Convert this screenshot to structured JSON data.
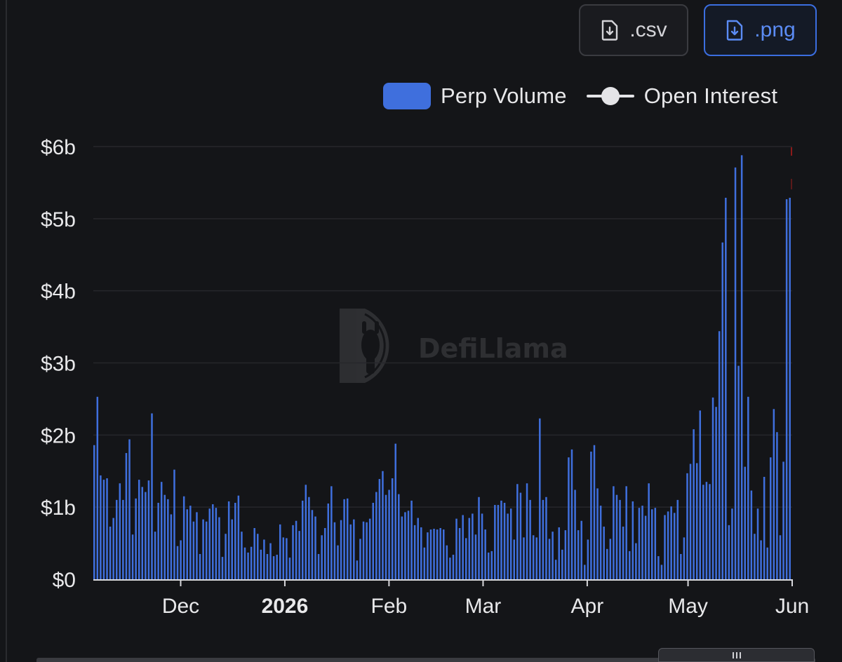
{
  "toolbar": {
    "csv_label": ".csv",
    "png_label": ".png",
    "icon": "file-download-icon"
  },
  "legend": {
    "items": [
      {
        "label": "Perp Volume",
        "color": "#3f6fdd",
        "icon": "bar-swatch"
      },
      {
        "label": "Open Interest",
        "color": "#e4e4e7",
        "icon": "line-dot-swatch"
      }
    ]
  },
  "watermark": "DefiLlama",
  "chart_data": {
    "type": "bar",
    "title": "",
    "xlabel": "",
    "ylabel": "",
    "ylim": [
      0,
      6000000000
    ],
    "y_ticks": [
      {
        "value": 0,
        "label": "$0"
      },
      {
        "value": 1000000000,
        "label": "$1b"
      },
      {
        "value": 2000000000,
        "label": "$2b"
      },
      {
        "value": 3000000000,
        "label": "$3b"
      },
      {
        "value": 4000000000,
        "label": "$4b"
      },
      {
        "value": 5000000000,
        "label": "$5b"
      },
      {
        "value": 6000000000,
        "label": "$6b"
      }
    ],
    "x_range": [
      "2025-11-05",
      "2026-06-01"
    ],
    "x_ticks": [
      {
        "date": "2025-12-01",
        "label": "Dec",
        "bold": false
      },
      {
        "date": "2026-01-01",
        "label": "2026",
        "bold": true
      },
      {
        "date": "2026-02-01",
        "label": "Feb",
        "bold": false
      },
      {
        "date": "2026-03-01",
        "label": "Mar",
        "bold": false
      },
      {
        "date": "2026-04-01",
        "label": "Apr",
        "bold": false
      },
      {
        "date": "2026-05-01",
        "label": "May",
        "bold": false
      },
      {
        "date": "2026-06-01",
        "label": "Jun",
        "bold": false
      }
    ],
    "grid": true,
    "legend_position": "top-right",
    "series": [
      {
        "name": "Perp Volume",
        "color": "#3f6fdd",
        "values_billions": [
          1.86,
          2.53,
          1.44,
          1.38,
          1.4,
          0.73,
          0.85,
          1.1,
          1.33,
          1.1,
          1.75,
          1.94,
          0.62,
          1.12,
          1.38,
          1.28,
          1.21,
          1.37,
          2.3,
          0.66,
          1.06,
          1.35,
          1.17,
          1.11,
          0.9,
          1.52,
          0.46,
          0.54,
          1.15,
          0.97,
          1.02,
          0.8,
          0.93,
          0.35,
          0.83,
          0.8,
          0.98,
          1.04,
          0.99,
          0.86,
          0.31,
          0.63,
          1.08,
          0.83,
          1.06,
          1.16,
          0.66,
          0.44,
          0.37,
          0.45,
          0.71,
          0.63,
          0.41,
          0.55,
          0.35,
          0.5,
          0.32,
          0.34,
          0.76,
          0.58,
          0.57,
          0.3,
          0.75,
          0.81,
          0.67,
          1.09,
          1.31,
          1.14,
          0.96,
          0.87,
          0.35,
          0.61,
          0.71,
          1.05,
          1.29,
          0.79,
          0.47,
          0.82,
          1.11,
          1.12,
          0.76,
          0.83,
          0.26,
          0.56,
          0.8,
          0.79,
          0.84,
          1.06,
          1.21,
          1.39,
          1.5,
          1.17,
          1.24,
          1.4,
          1.88,
          1.18,
          0.87,
          0.93,
          0.95,
          1.09,
          0.75,
          0.85,
          0.72,
          0.44,
          0.65,
          0.69,
          0.7,
          0.69,
          0.71,
          0.69,
          0.47,
          0.3,
          0.34,
          0.84,
          0.71,
          0.89,
          0.57,
          0.85,
          0.91,
          0.62,
          1.14,
          0.91,
          0.69,
          0.37,
          0.39,
          1.03,
          1.03,
          1.09,
          1.06,
          0.91,
          0.98,
          0.55,
          1.32,
          1.2,
          0.58,
          1.33,
          1.1,
          0.61,
          0.58,
          2.23,
          1.1,
          1.14,
          0.56,
          0.66,
          0.27,
          0.72,
          0.41,
          0.68,
          1.69,
          1.8,
          1.24,
          0.68,
          0.81,
          0.2,
          0.55,
          1.77,
          1.86,
          1.26,
          1.02,
          0.73,
          0.42,
          0.56,
          1.29,
          1.17,
          1.1,
          0.73,
          1.29,
          0.39,
          1.08,
          0.5,
          0.99,
          1.02,
          0.88,
          1.33,
          0.97,
          0.99,
          0.32,
          0.2,
          0.89,
          0.94,
          1.01,
          0.92,
          1.1,
          0.35,
          0.58,
          1.47,
          1.6,
          2.08,
          1.61,
          2.34,
          1.31,
          1.35,
          1.32,
          2.52,
          2.39,
          3.44,
          4.67,
          5.29,
          0.75,
          0.98,
          5.71,
          2.96,
          5.88,
          1.56,
          2.53,
          1.23,
          0.63,
          0.98,
          0.54,
          1.42,
          0.44,
          1.69,
          2.36,
          2.04,
          0.61,
          1.63,
          5.27,
          5.29
        ]
      }
    ]
  }
}
